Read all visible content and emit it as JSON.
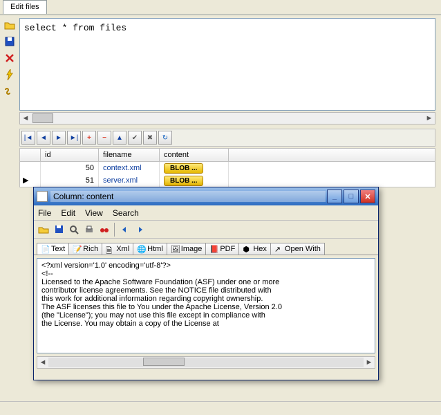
{
  "tabs": {
    "edit_files": "Edit files"
  },
  "sql": "select * from files",
  "grid": {
    "headers": {
      "id": "id",
      "filename": "filename",
      "content": "content"
    },
    "rows": [
      {
        "id": "50",
        "filename": "context.xml",
        "content": "BLOB ..."
      },
      {
        "id": "51",
        "filename": "server.xml",
        "content": "BLOB ..."
      }
    ]
  },
  "dialog": {
    "title": "Column: content",
    "menu": {
      "file": "File",
      "edit": "Edit",
      "view": "View",
      "search": "Search"
    },
    "tabs": {
      "text": "Text",
      "rich": "Rich",
      "xml": "Xml",
      "html": "Html",
      "image": "Image",
      "pdf": "PDF",
      "hex": "Hex",
      "openwith": "Open With"
    },
    "content_lines": [
      "<?xml version='1.0' encoding='utf-8'?>",
      "<!--",
      "  Licensed to the Apache Software Foundation (ASF) under one or more",
      "  contributor license agreements.  See the NOTICE file distributed with",
      "  this work for additional information regarding copyright ownership.",
      "  The ASF licenses this file to You under the Apache License, Version 2.0",
      "  (the \"License\"); you may not use this file except in compliance with",
      "  the License.  You may obtain a copy of the License at"
    ]
  },
  "colors": {
    "blob_bg": "#f5cc00",
    "link": "#1040a0"
  }
}
